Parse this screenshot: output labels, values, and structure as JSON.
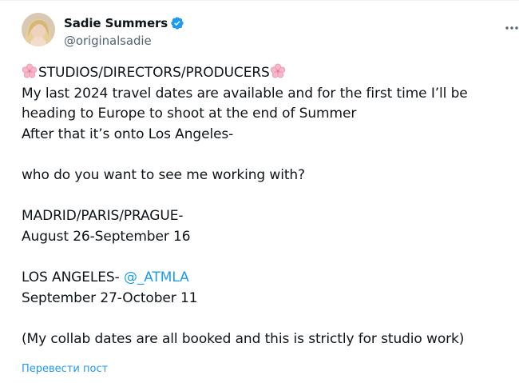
{
  "author": {
    "display_name": "Sadie Summers",
    "handle": "@originalsadie",
    "avatar_icon": "profile-photo",
    "verified_icon": "verified-badge-icon"
  },
  "menu": {
    "more_icon": "more-horizontal-icon"
  },
  "tweet": {
    "line1": "STUDIOS/DIRECTORS/PRODUCERS",
    "line2": "My last 2024 travel dates are available and for the first time I’ll be",
    "line3": "heading to Europe to shoot at the end of Summer",
    "line4": "After that it’s onto Los Angeles-",
    "line5": "who do you want to see me working with?",
    "line6": "MADRID/PARIS/PRAGUE-",
    "line7": "August 26-September 16",
    "line8_prefix": "LOS ANGELES- ",
    "line8_mention": "@_ATMLA",
    "line9": "September 27-October 11",
    "line10": "(My collab dates are all booked and this is strictly for studio work)"
  },
  "translate_label": "Перевести пост",
  "colors": {
    "text": "#0f1419",
    "secondary": "#536471",
    "link": "#1d9bf0",
    "flower": "#f7b7c9"
  }
}
